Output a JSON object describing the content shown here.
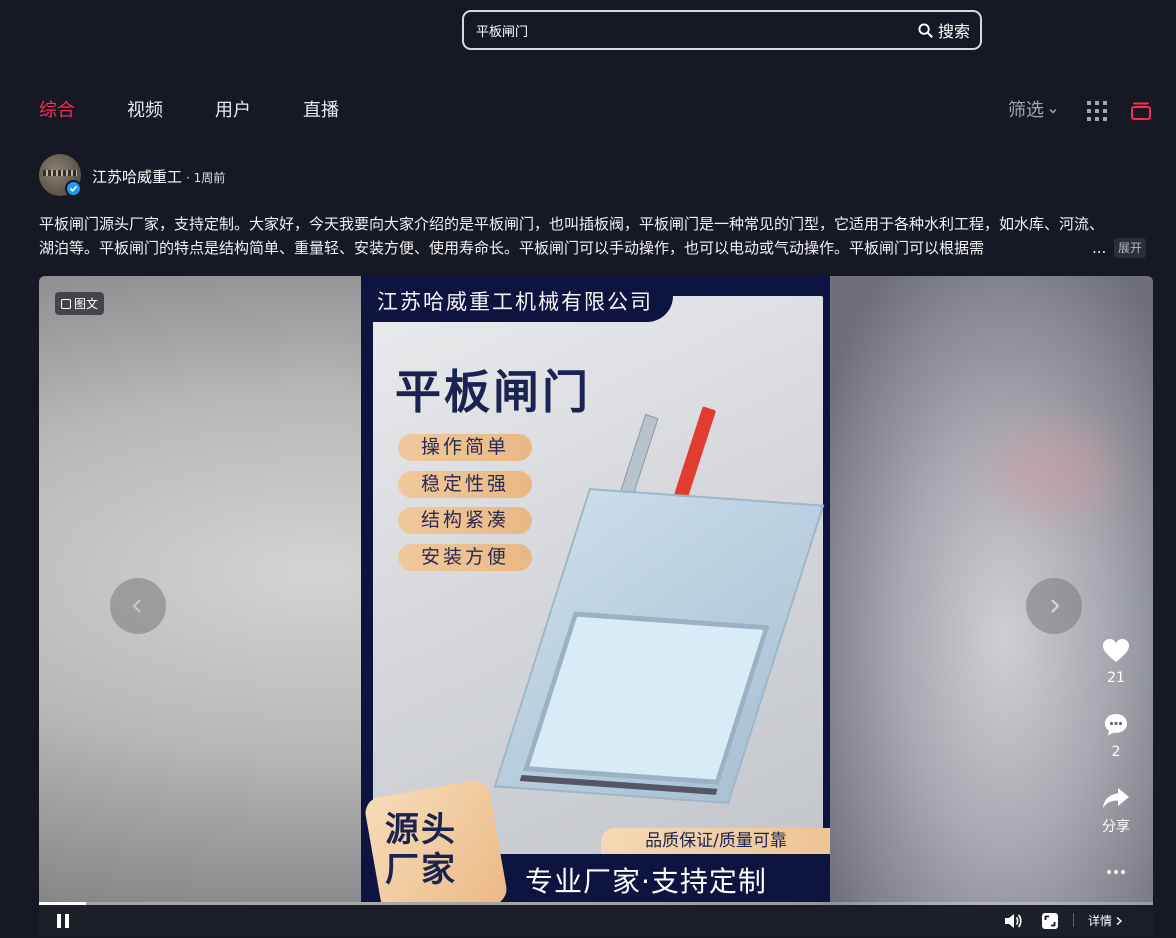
{
  "search": {
    "value": "平板闸门",
    "button_label": "搜索"
  },
  "tabs": [
    {
      "label": "综合",
      "active": true
    },
    {
      "label": "视频",
      "active": false
    },
    {
      "label": "用户",
      "active": false
    },
    {
      "label": "直播",
      "active": false
    }
  ],
  "filter_label": "筛选",
  "post": {
    "author": "江苏哈威重工",
    "time": "· 1周前",
    "description": "平板闸门源头厂家，支持定制。大家好，今天我要向大家介绍的是平板闸门，也叫插板阀，平板闸门是一种常见的门型，它适用于各种水利工程，如水库、河流、湖泊等。平板闸门的特点是结构简单、重量轻、安装方便、使用寿命长。平板闸门可以手动操作，也可以电动或气动操作。平板闸门可以根据需",
    "ellipsis": "...",
    "expand_label": "展开",
    "badge_label": "图文"
  },
  "poster": {
    "company": "江苏哈威重工机械有限公司",
    "title": "平板闸门",
    "features": [
      "操作简单",
      "稳定性强",
      "结构紧凑",
      "安装方便"
    ],
    "source_line1": "源头",
    "source_line2": "厂家",
    "quality": "品质保证/质量可靠",
    "slogan": "专业厂家·支持定制"
  },
  "actions": {
    "likes": "21",
    "comments": "2",
    "share_label": "分享"
  },
  "player": {
    "details_label": "详情",
    "progress": 0.042
  },
  "colors": {
    "accent": "#fe2c55",
    "background": "#161823",
    "verified": "#1f9bf0"
  }
}
